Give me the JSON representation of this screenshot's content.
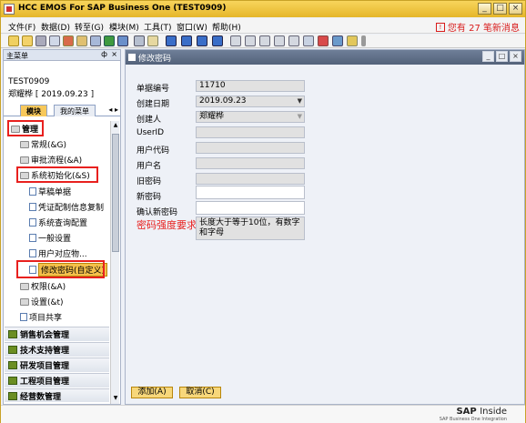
{
  "window": {
    "title": "HCC EMOS For SAP Business One (TEST0909)",
    "controls": [
      "_",
      "□",
      "×"
    ]
  },
  "menu": {
    "items": [
      "文件(F)",
      "数据(D)",
      "转至(G)",
      "模块(M)",
      "工具(T)",
      "窗口(W)",
      "帮助(H)"
    ],
    "alert": "您有 27 笔新消息"
  },
  "main_menu_panel": {
    "title": "主菜单",
    "pin": "ф",
    "close": "×",
    "user_code": "TEST0909",
    "user_name_date": "郑耀桦 [ 2019.09.23 ]",
    "tabs": [
      "模块",
      "我的菜单"
    ],
    "tab_arrows": "◂ ▸",
    "tree": {
      "management": "管理",
      "general": "常规(&G)",
      "approval": "审批流程(&A)",
      "sys_init": "系统初始化(&S)",
      "init_items": [
        "草稿单据",
        "凭证配制信息复制",
        "系统查询配置",
        "一般设置",
        "用户对应物..."
      ],
      "change_password": "修改密码(自定义)",
      "permissions": "权限(&A)",
      "settings": "设置(&t)",
      "project_share": "项目共享"
    },
    "modules": [
      "销售机会管理",
      "技术支持管理",
      "研发项目管理",
      "工程项目管理",
      "经营数管理"
    ]
  },
  "form": {
    "title": "修改密码",
    "fields": [
      {
        "label": "单据编号",
        "value": "11710"
      },
      {
        "label": "创建日期",
        "value": "2019.09.23"
      },
      {
        "label": "创建人",
        "value": "郑耀桦"
      },
      {
        "label": "UserID",
        "value": ""
      },
      {
        "label": "用户代码",
        "value": ""
      },
      {
        "label": "用户名",
        "value": ""
      },
      {
        "label": "旧密码",
        "value": ""
      },
      {
        "label": "新密码",
        "value": ""
      },
      {
        "label": "确认新密码",
        "value": ""
      }
    ],
    "requirement_label": "密码强度要求",
    "requirement_text": "长度大于等于10位，有数字和字母",
    "add_button": "添加(A)",
    "cancel_button": "取消(C)"
  },
  "footer": {
    "brand": "SAP",
    "brand_suffix": "Inside",
    "brand_sub": "SAP Business One Integration"
  },
  "colors": {
    "title_bar": "#e5b62a",
    "highlight": "#f5c04a",
    "annotation": "#e8201e",
    "form_title": "#53627a"
  }
}
